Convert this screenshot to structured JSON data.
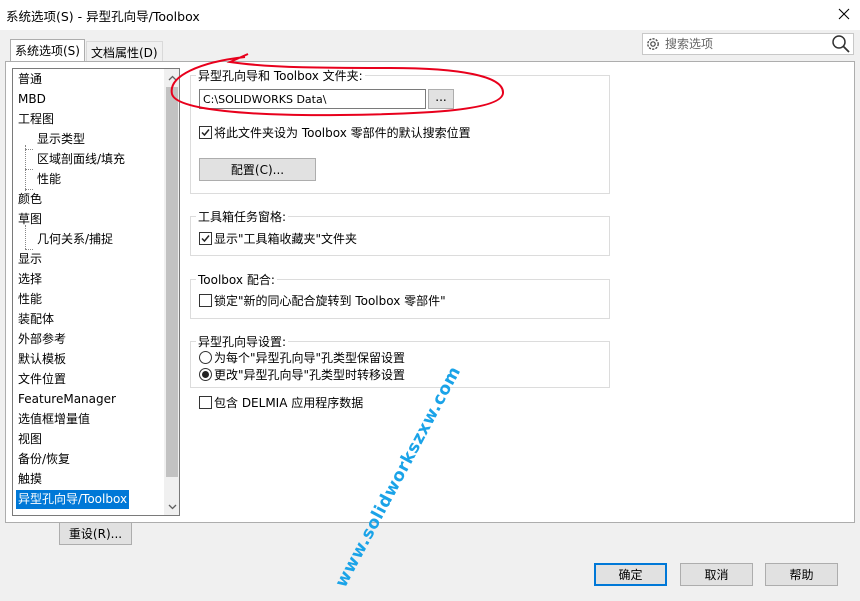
{
  "window": {
    "title": "系统选项(S) - 异型孔向导/Toolbox"
  },
  "tabs": [
    {
      "label": "系统选项(S)",
      "active": true
    },
    {
      "label": "文档属性(D)",
      "active": false
    }
  ],
  "search": {
    "placeholder": "搜索选项"
  },
  "tree": {
    "items": [
      {
        "label": "普通",
        "level": 0
      },
      {
        "label": "MBD",
        "level": 0
      },
      {
        "label": "工程图",
        "level": 0
      },
      {
        "label": "显示类型",
        "level": 1
      },
      {
        "label": "区域剖面线/填充",
        "level": 1
      },
      {
        "label": "性能",
        "level": 1
      },
      {
        "label": "颜色",
        "level": 0
      },
      {
        "label": "草图",
        "level": 0
      },
      {
        "label": "几何关系/捕捉",
        "level": 1
      },
      {
        "label": "显示",
        "level": 0
      },
      {
        "label": "选择",
        "level": 0
      },
      {
        "label": "性能",
        "level": 0
      },
      {
        "label": "装配体",
        "level": 0
      },
      {
        "label": "外部参考",
        "level": 0
      },
      {
        "label": "默认模板",
        "level": 0
      },
      {
        "label": "文件位置",
        "level": 0
      },
      {
        "label": "FeatureManager",
        "level": 0
      },
      {
        "label": "选值框增量值",
        "level": 0
      },
      {
        "label": "视图",
        "level": 0
      },
      {
        "label": "备份/恢复",
        "level": 0
      },
      {
        "label": "触摸",
        "level": 0
      },
      {
        "label": "异型孔向导/Toolbox",
        "level": 0,
        "selected": true
      }
    ]
  },
  "reset_button": "重设(R)...",
  "toolbox_folder": {
    "title": "异型孔向导和 Toolbox 文件夹:",
    "path": "C:\\SOLIDWORKS Data\\",
    "browse_label": "...",
    "default_search_label": "将此文件夹设为 Toolbox 零部件的默认搜索位置",
    "default_search_checked": true,
    "configure_label": "配置(C)..."
  },
  "toolbox_task_pane": {
    "title": "工具箱任务窗格:",
    "show_favorites_label": "显示\"工具箱收藏夹\"文件夹",
    "show_favorites_checked": true
  },
  "toolbox_mate": {
    "title": "Toolbox 配合:",
    "lock_rotation_label": "锁定\"新的同心配合旋转到 Toolbox 零部件\"",
    "lock_rotation_checked": false
  },
  "hole_wizard": {
    "title": "异型孔向导设置:",
    "radio_keep_label": "为每个\"异型孔向导\"孔类型保留设置",
    "radio_transfer_label": "更改\"异型孔向导\"孔类型时转移设置",
    "selected": "transfer"
  },
  "delmia": {
    "label": "包含 DELMIA 应用程序数据",
    "checked": false
  },
  "watermark": "www.solidworkszxw.com",
  "footer": {
    "ok": "确定",
    "cancel": "取消",
    "help": "帮助"
  },
  "colors": {
    "selection": "#0078d7",
    "annotation": "#e8001c",
    "watermark": "#1aa3e8"
  }
}
